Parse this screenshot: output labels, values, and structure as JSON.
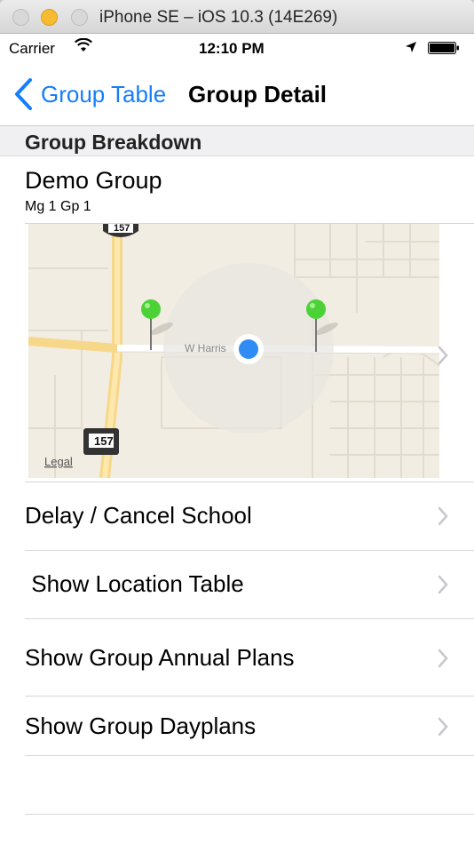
{
  "window": {
    "title": "iPhone SE – iOS 10.3 (14E269)"
  },
  "status_bar": {
    "carrier": "Carrier",
    "time": "12:10 PM"
  },
  "nav": {
    "back_label": "Group Table",
    "title": "Group Detail"
  },
  "section": {
    "header": "Group Breakdown"
  },
  "group": {
    "name": "Demo Group",
    "subtitle": "Mg 1 Gp 1"
  },
  "map": {
    "street_label": "W Harris",
    "highway_shield": "157",
    "legal_label": "Legal"
  },
  "menu": [
    {
      "label": "Delay / Cancel School"
    },
    {
      "label": " Show Location Table"
    },
    {
      "label": "Show Group Annual Plans"
    },
    {
      "label": "Show Group Dayplans"
    }
  ],
  "colors": {
    "ios_blue": "#157efb",
    "pin_green": "#4cd137",
    "user_dot": "#2f8cf5",
    "titlebar_minimize": "#f6bb30"
  }
}
